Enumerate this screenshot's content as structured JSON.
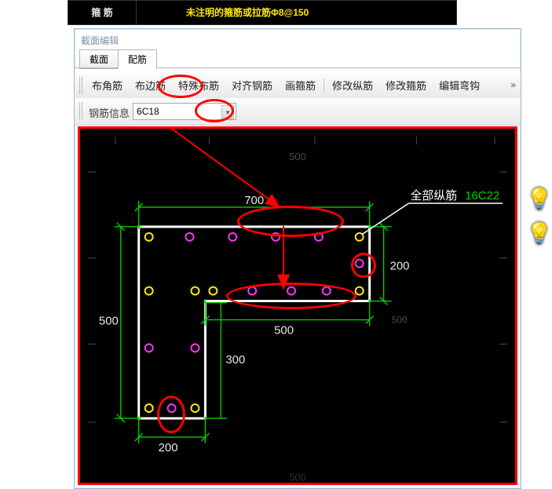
{
  "top_strip": {
    "left_cell": "箍 筋",
    "text": "未注明的箍筋或拉筋Φ8@150"
  },
  "window": {
    "title": "截面编辑",
    "tabs": [
      {
        "label": "截面",
        "active": false
      },
      {
        "label": "配筋",
        "active": true
      }
    ],
    "toolbar": {
      "buttons": [
        "布角筋",
        "布边筋",
        "特殊布筋",
        "对齐钢筋",
        "画箍筋",
        "修改纵筋",
        "修改箍筋",
        "编辑弯钩"
      ],
      "overflow_glyph": "»"
    },
    "option_row": {
      "label": "钢筋信息",
      "value": "6C18"
    }
  },
  "drawing": {
    "axis_labels": {
      "top_500": "500",
      "bottom_500_shadow": "500"
    },
    "dims": {
      "d700": "700",
      "d200_right": "200",
      "d500_mid": "500",
      "d500_left": "500",
      "d300": "300",
      "d200_bottom": "200",
      "d500_right_small": "500"
    },
    "annotations": {
      "all_rebar_label": "全部纵筋",
      "all_rebar_value": "16C22"
    }
  },
  "bulbs": {
    "icon": "💡"
  }
}
